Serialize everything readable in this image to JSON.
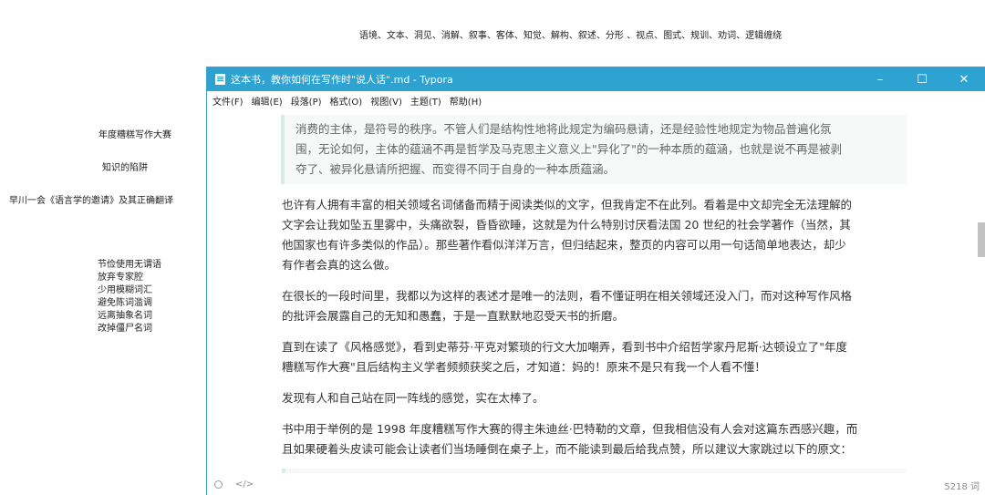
{
  "top_keywords": "语境、文本、洞见、消解、叙事、客体、知觉、解构、叙述、分形 、视点、图式、规训、劝词、逻辑缠绕",
  "notes": {
    "contest": "年度糟糕写作大赛",
    "trap": "知识的陷阱",
    "book": "早川一会《语言学的邀请》及其正确翻译",
    "list": [
      "节俭使用无谓语",
      "放弃专家腔",
      "少用模糊词汇",
      "避免陈词滥调",
      "远离抽象名词",
      "改掉僵尸名词"
    ]
  },
  "window": {
    "title": "这本书，教你如何在写作时\"说人话\".md - Typora",
    "controls": {
      "minimize": "–",
      "maximize": "☐",
      "close": "✕"
    }
  },
  "menu": [
    "文件(F)",
    "编辑(E)",
    "段落(P)",
    "格式(O)",
    "视图(V)",
    "主题(T)",
    "帮助(H)"
  ],
  "doc": {
    "quote1_l1": "消费的主体，是符号的秩序。不管人们是结构性地将此规定为编码悬请，还是经验性地规定为物品普遍化氛",
    "quote1_l2": "围，无论如何，主体的蕴涵不再是哲学及马克思主义意义上\"异化了\"的一种本质的蕴涵，也就是说不再是被剥",
    "quote1_l3": "夺了、被异化悬请所把握、而变得不同于自身的一种本质蕴涵。",
    "p1_l1": "也许有人拥有丰富的相关领域名词储备而精于阅读类似的文字，但我肯定不在此列。看着是中文却完全无法理解的",
    "p1_l2": "文字会让我如坠五里雾中，头痛欲裂，昏昏欲睡，这就是为什么特别讨厌看法国 20 世纪的社会学著作（当然，其",
    "p1_l3": "他国家也有许多类似的作品）。那些著作看似洋洋万言，但归结起来，整页的内容可以用一句话简单地表达，却少",
    "p1_l4": "有作者会真的这么做。",
    "p2_l1": "在很长的一段时间里，我都以为这样的表述才是唯一的法则，看不懂证明在相关领域还没入门，而对这种写作风格",
    "p2_l2": "的批评会展露自己的无知和愚蠢，于是一直默默地忍受天书的折磨。",
    "p3_l1": "直到在读了《风格感觉》，看到史蒂芬·平克对繁琐的行文大加嘲弄，看到书中介绍哲学家丹尼斯·达顿设立了\"年度",
    "p3_l2": "糟糕写作大赛\"且后结构主义学者频频获奖之后，才知道：妈的！原来不是只有我一个人看不懂！",
    "p4_l1": "发现有人和自己站在同一阵线的感觉，实在太棒了。",
    "p5_l1": "书中用于举例的是 1998 年度糟糕写作大赛的得主朱迪丝·巴特勒的文章，但我相信没有人会对这篇东西感兴趣，而",
    "p5_l2": "且如果硬着头皮读可能会让读者们当场睡倒在桌子上，而不能读到最后给我点赞，所以建议大家跳过以下的原文："
  },
  "status": {
    "source_code": "</>",
    "word_count": "5218 词"
  },
  "colors": {
    "titlebar": "#2ea2d1",
    "quote_border": "#d9ece4",
    "quote_bg": "#f6f9f7"
  }
}
